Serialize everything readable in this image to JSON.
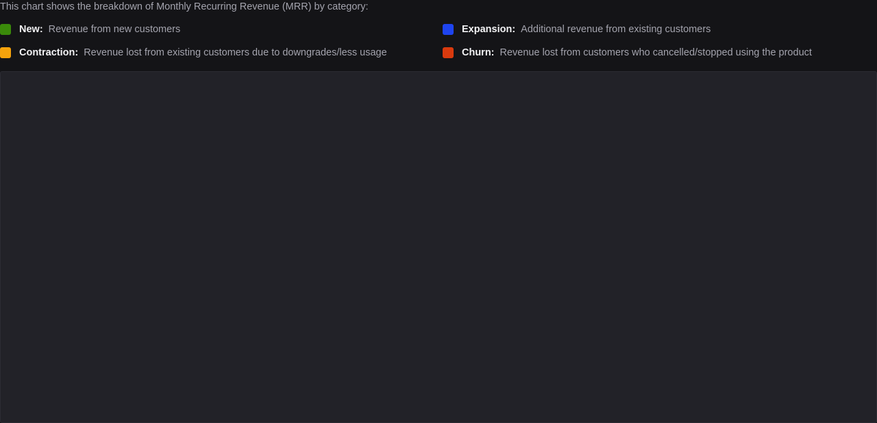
{
  "intro_text": "This chart shows the breakdown of Monthly Recurring Revenue (MRR) by category:",
  "legend": [
    {
      "name": "New:",
      "description": "Revenue from new customers",
      "color": "#3a8a0a"
    },
    {
      "name": "Expansion:",
      "description": "Additional revenue from existing customers",
      "color": "#1e44f0"
    },
    {
      "name": "Contraction:",
      "description": "Revenue lost from existing customers due to downgrades/less usage",
      "color": "#f4a20c"
    },
    {
      "name": "Churn:",
      "description": "Revenue lost from customers who cancelled/stopped using the product",
      "color": "#d93a0e"
    }
  ],
  "colors": {
    "background": "#141417",
    "panel": "#222228",
    "text_primary": "#f2f2f4",
    "text_secondary": "#a3a3ad"
  }
}
